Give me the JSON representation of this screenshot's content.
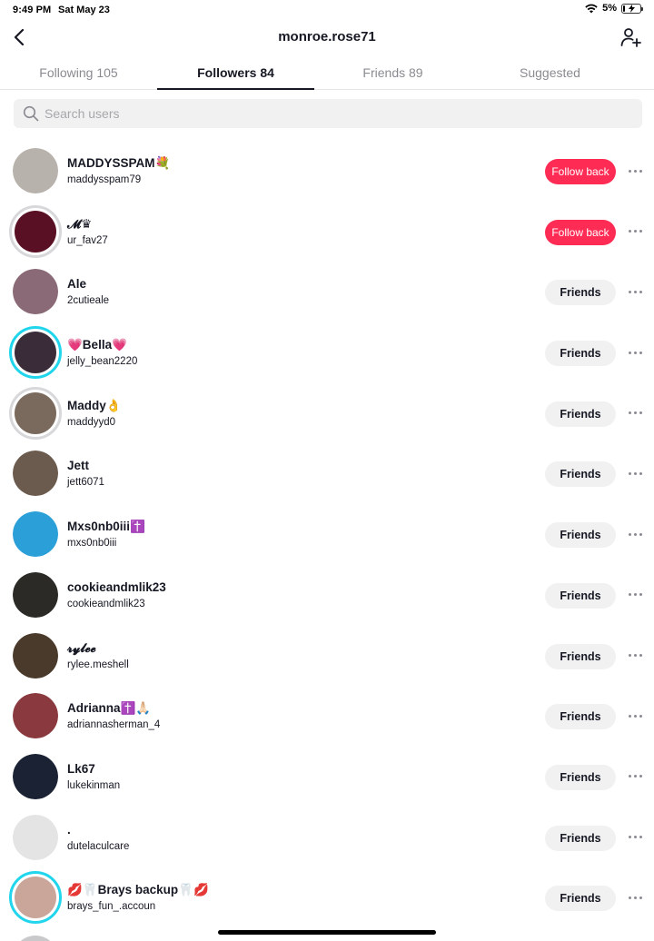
{
  "status": {
    "time": "9:49 PM",
    "date": "Sat May 23",
    "battery": "5%"
  },
  "header": {
    "title": "monroe.rose71",
    "back_icon": "chevron-left-icon",
    "add_icon": "add-user-icon"
  },
  "tabs": [
    {
      "label": "Following 105",
      "active": false
    },
    {
      "label": "Followers 84",
      "active": true
    },
    {
      "label": "Friends 89",
      "active": false
    },
    {
      "label": "Suggested",
      "active": false
    }
  ],
  "search": {
    "placeholder": "Search users"
  },
  "colors": {
    "accent": "#fe2c55",
    "story_ring": "#20d5ec",
    "button_gray": "#f1f1f2"
  },
  "users": [
    {
      "name": "MADDYSSPAM💐",
      "handle": "maddysspam79",
      "button": "Follow back",
      "avatar_color": "#b8b2ad",
      "ring": "none"
    },
    {
      "name": "𝓜♛",
      "handle": "ur_fav27",
      "button": "Follow back",
      "avatar_color": "#5a1024",
      "ring": "seen"
    },
    {
      "name": "Ale",
      "handle": "2cutieale",
      "button": "Friends",
      "avatar_color": "#8a6a76",
      "ring": "none"
    },
    {
      "name": "💗Bella💗",
      "handle": "jelly_bean2220",
      "button": "Friends",
      "avatar_color": "#3b2c3a",
      "ring": "story"
    },
    {
      "name": "Maddy👌",
      "handle": "maddyyd0",
      "button": "Friends",
      "avatar_color": "#7a6a5d",
      "ring": "seen"
    },
    {
      "name": "Jett",
      "handle": "jett6071",
      "button": "Friends",
      "avatar_color": "#6b5b4e",
      "ring": "none"
    },
    {
      "name": "Mxs0nb0iii✝️",
      "handle": "mxs0nb0iii",
      "button": "Friends",
      "avatar_color": "#2a9fd8",
      "ring": "none"
    },
    {
      "name": "cookieandmlik23",
      "handle": "cookieandmlik23",
      "button": "Friends",
      "avatar_color": "#2b2a26",
      "ring": "none"
    },
    {
      "name": "𝓻𝔂𝓵𝓮𝓮",
      "handle": "rylee.meshell",
      "button": "Friends",
      "avatar_color": "#4a3a2b",
      "ring": "none"
    },
    {
      "name": "Adrianna✝️🙏🏻",
      "handle": "adriannasherman_4",
      "button": "Friends",
      "avatar_color": "#8a3a3f",
      "ring": "none"
    },
    {
      "name": "Lk67",
      "handle": "lukekinman",
      "button": "Friends",
      "avatar_color": "#1b2233",
      "ring": "none"
    },
    {
      "name": ".",
      "handle": "dutelaculcare",
      "button": "Friends",
      "avatar_color": "#e4e4e4",
      "ring": "none"
    },
    {
      "name": "💋🦷Brays backup🦷💋",
      "handle": "brays_fun_.accoun",
      "button": "Friends",
      "avatar_color": "#caa59a",
      "ring": "story"
    }
  ]
}
